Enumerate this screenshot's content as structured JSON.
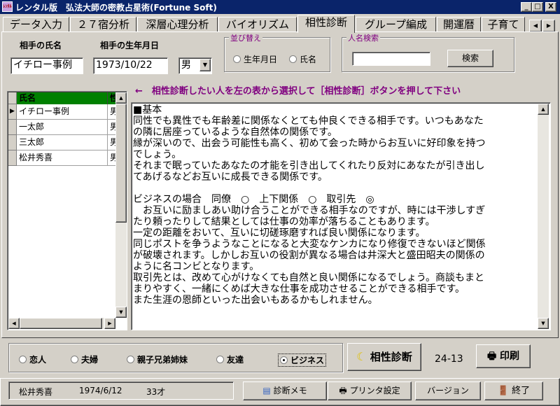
{
  "window": {
    "title": "レンタル版　弘法大師の密教占星術(Fortune Soft)",
    "icon_label": "ﾚﾝﾀﾙ",
    "buttons": {
      "minimize": "_",
      "maximize": "□",
      "close": "X"
    }
  },
  "tabs": [
    {
      "label": "データ入力",
      "active": false
    },
    {
      "label": "２７宿分析",
      "active": false
    },
    {
      "label": "深層心理分析",
      "active": false
    },
    {
      "label": "バイオリズム",
      "active": false
    },
    {
      "label": "相性診断",
      "active": true
    },
    {
      "label": "グループ編成",
      "active": false
    },
    {
      "label": "開運暦",
      "active": false
    },
    {
      "label": "子育て",
      "active": false
    }
  ],
  "form": {
    "name_label": "相手の氏名",
    "name_value": "イチロー事例",
    "birth_label": "相手の生年月日",
    "birth_value": "1973/10/22",
    "gender_value": "男"
  },
  "sort": {
    "title": "並び替え",
    "options": [
      {
        "label": "生年月日",
        "selected": false
      },
      {
        "label": "氏名",
        "selected": false
      }
    ]
  },
  "search": {
    "title": "人名検索",
    "value": "",
    "button": "検索"
  },
  "instruction": "←　相性診断したい人を左の表から選択して［相性診断］ボタンを押して下さい",
  "grid": {
    "headers": [
      "氏名",
      "性別"
    ],
    "rows": [
      {
        "name": "イチロー事例",
        "sex": "男",
        "current": true
      },
      {
        "name": "一太郎",
        "sex": "男",
        "current": false
      },
      {
        "name": "三太郎",
        "sex": "男",
        "current": false
      },
      {
        "name": "松井秀喜",
        "sex": "男",
        "current": false
      }
    ]
  },
  "result_text": "■基本\n同性でも異性でも年齢差に関係なくとても仲良くできる相手です。いつもあなた\nの隣に居座っているような自然体の関係です。\n縁が深いので、出会う可能性も高く、初めて会った時からお互いに好印象を持つ\nでしょう。\nそれまで眠っていたあなたの才能を引き出してくれたり反対にあなたが引き出し\nてあげるなどお互いに成長できる関係です。\n\nビジネスの場合　同僚　○　上下関係　○　取引先　◎\n　お互いに励ましあい助け合うことができる相手なのですが、時には干渉しすぎ\nたり頼ったりして結果としては仕事の効率が落ちることもあります。\n一定の距離をおいて、互いに切磋琢磨すれば良い関係になります。\n同じポストを争うようなことになると大変なケンカになり修復できないほど関係\nが破壊されます。しかしお互いの役割が異なる場合は井深大と盛田昭夫の関係の\nように名コンビとなります。\n取引先とは、改めて心がけなくても自然と良い関係になるでしょう。商談もまと\nまりやすく、一緒にくめば大きな仕事を成功させることができる相手です。\nまた生涯の恩師といった出会いもあるかもしれません。",
  "relation_types": [
    {
      "label": "恋人",
      "selected": false
    },
    {
      "label": "夫婦",
      "selected": false
    },
    {
      "label": "親子兄弟姉妹",
      "selected": false
    },
    {
      "label": "友達",
      "selected": false
    },
    {
      "label": "ビジネス",
      "selected": true
    }
  ],
  "diagnose_button": "相性診断",
  "code": "24-13",
  "print_button": "印刷",
  "status": {
    "name": "松井秀喜",
    "birth": "1974/6/12",
    "age": "33才"
  },
  "bottom_buttons": {
    "memo": "診断メモ",
    "printer": "プリンタ設定",
    "version": "バージョン",
    "exit": "終了"
  },
  "colors": {
    "title_bar": "#0a246a",
    "accent_purple": "#800080",
    "grid_header": "#008000"
  }
}
